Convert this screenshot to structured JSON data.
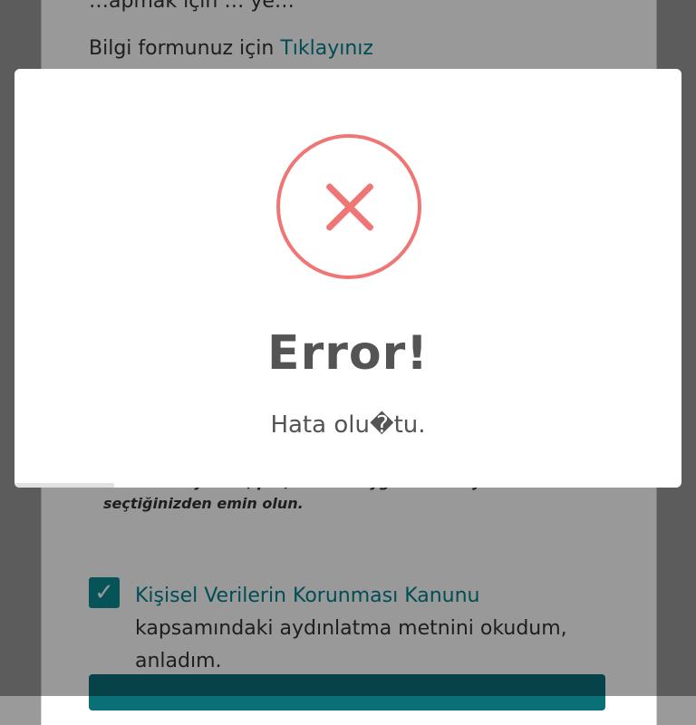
{
  "background_page": {
    "top_line_partial": "…apmak için … ye…",
    "info_form_prefix": "Bilgi formunuz için",
    "info_form_link": "Tıklayınız",
    "file_note": "ve PDF dosyaları (.pdf). Lütfen uygun bir dosya seçtiğinizden emin olun.",
    "kvkk_checked": true,
    "kvkk_link": "Kişisel Verilerin Korunması Kanunu",
    "kvkk_text": "kapsamındaki aydınlatma metnini okudum, anladım."
  },
  "modal": {
    "icon": "error-x-circle-icon",
    "title": "Error!",
    "message": "Hata olu�tu.",
    "timer_progress_fraction": 0.15,
    "accent_color": "#f07676"
  },
  "colors": {
    "teal": "#00808a",
    "overlay": "rgba(0,0,0,0.40)"
  }
}
